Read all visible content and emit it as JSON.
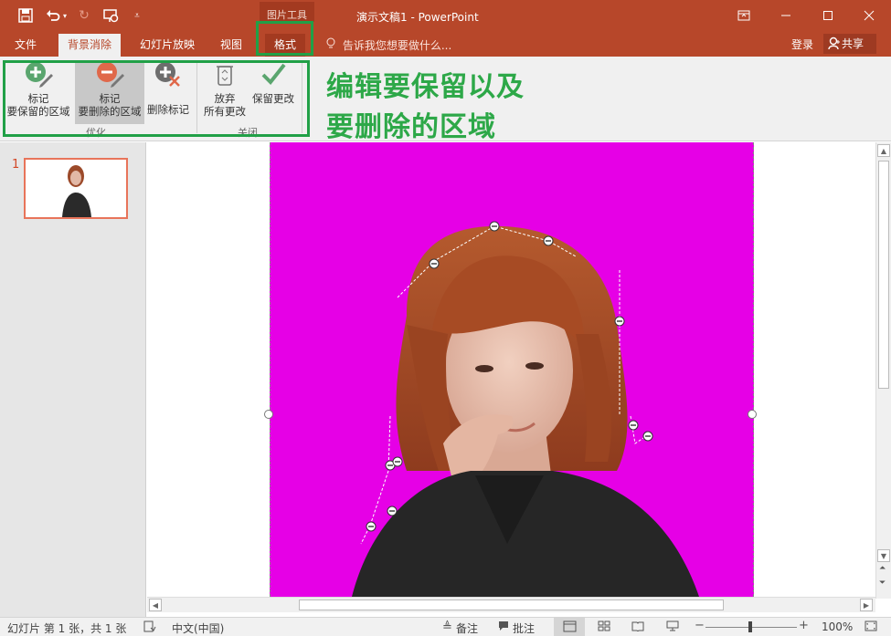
{
  "title_bar": {
    "doc_title": "演示文稿1 - PowerPoint",
    "context_group": "图片工具",
    "quick_access": [
      "save-icon",
      "undo-icon",
      "redo-icon",
      "start-slideshow-icon",
      "customize-icon"
    ],
    "window_controls": [
      "ribbon-display-icon",
      "minimize-icon",
      "restore-icon",
      "close-icon"
    ]
  },
  "tabs": {
    "items": [
      "文件",
      "背景消除",
      "幻灯片放映",
      "视图",
      "格式"
    ],
    "active": "背景消除",
    "tell_me": "告诉我您想要做什么...",
    "login": "登录",
    "share": "共享"
  },
  "ribbon": {
    "refine_group": {
      "label": "优化",
      "mark_keep": {
        "line1": "标记",
        "line2": "要保留的区域"
      },
      "mark_remove": {
        "line1": "标记",
        "line2": "要删除的区域"
      },
      "delete_mark": "删除标记"
    },
    "close_group": {
      "label": "关闭",
      "discard": {
        "line1": "放弃",
        "line2": "所有更改"
      },
      "keep_changes": "保留更改"
    }
  },
  "annotation": {
    "line1": "编辑要保留以及",
    "line2": "要删除的区域"
  },
  "thumbnail": {
    "slide_number": "1"
  },
  "status_bar": {
    "slide_info": "幻灯片 第 1 张，共 1 张",
    "language": "中文(中国)",
    "notes": "备注",
    "comments": "批注",
    "zoom_level": "100%",
    "zoom_fraction": 0.5
  },
  "colors": {
    "accent": "#b7472a",
    "highlight": "#21a047",
    "removal_overlay": "#e600e6"
  }
}
